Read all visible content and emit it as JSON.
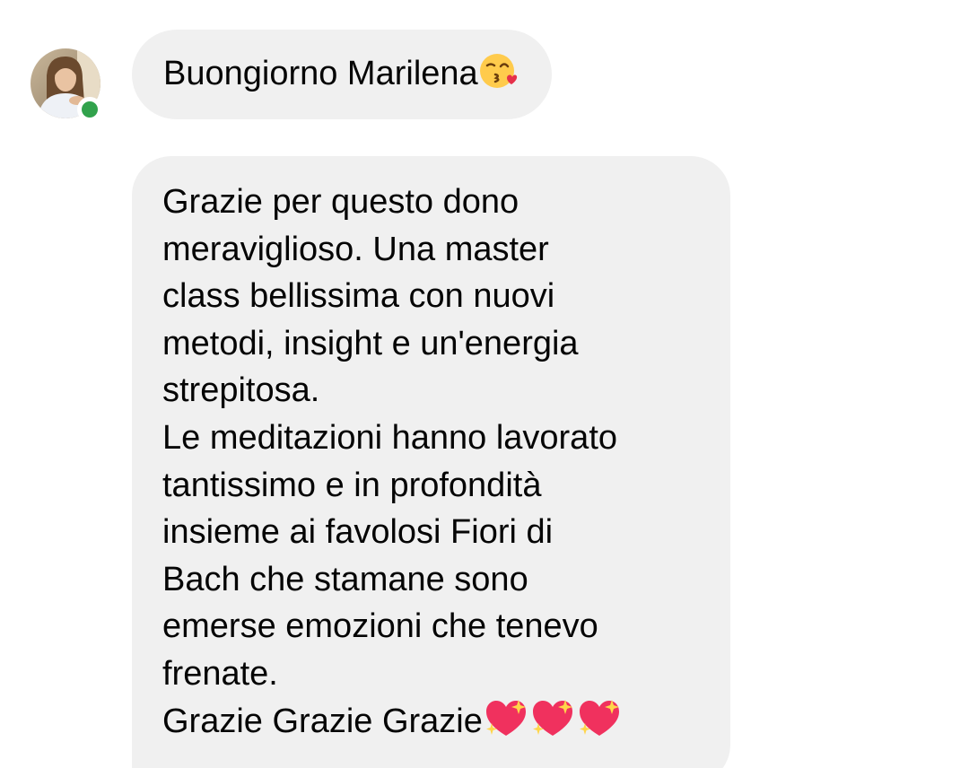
{
  "conversation": {
    "contact": {
      "avatar_icon": "profile-photo",
      "online": true,
      "presence_color": "#31a24c"
    },
    "messages": [
      {
        "text": "Buongiorno Marilena",
        "trailing_emoji": [
          "kissing-face-heart-emoji"
        ]
      },
      {
        "text": "Grazie per questo dono\nmeraviglioso. Una master\nclass bellissima con nuovi\nmetodi, insight e un'energia\nstrepitosa.\nLe meditazioni hanno lavorato\ntantissimo e in profondità\ninsieme ai favolosi Fiori di\nBach che stamane sono\nemerse emozioni che tenevo\nfrenate.\nGrazie Grazie Grazie",
        "trailing_emoji": [
          "sparkling-heart-emoji",
          "sparkling-heart-emoji",
          "sparkling-heart-emoji"
        ]
      }
    ],
    "bubble_color": "#f0f0f0"
  }
}
